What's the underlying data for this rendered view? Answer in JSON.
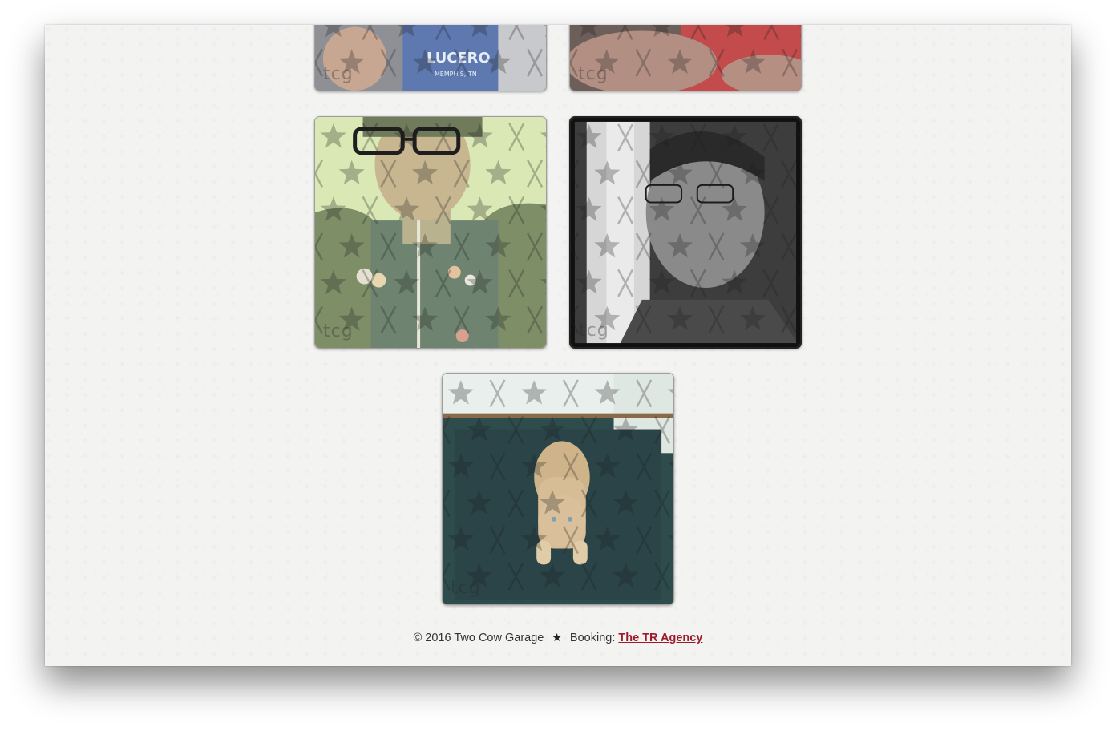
{
  "gallery": {
    "watermark": "tcg",
    "photos": [
      {
        "subject": "person-in-lucero-shirt",
        "shirt_text": "LUCERO",
        "shirt_subtext": "MEMPHIS, TN"
      },
      {
        "subject": "tattooed-arm-red-shirt"
      },
      {
        "subject": "man-with-glasses-denim-vest"
      },
      {
        "subject": "man-with-glasses-bw"
      },
      {
        "subject": "puppy-on-doormat"
      }
    ]
  },
  "footer": {
    "copyright": "© 2016 Two Cow Garage",
    "separator_icon": "star-icon",
    "booking_label": "Booking:",
    "booking_link": "The TR Agency"
  },
  "colors": {
    "link": "#9b1b2a",
    "background": "#f3f3f2"
  }
}
